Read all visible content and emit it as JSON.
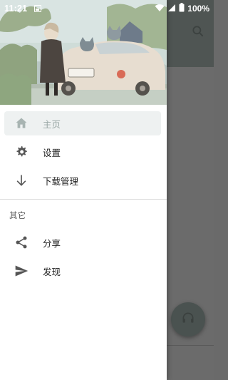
{
  "status_bar": {
    "time": "11:21",
    "battery": "100%"
  },
  "drawer": {
    "header_image": "anime-girl-with-car-illustration",
    "primary_items": [
      {
        "label": "主页",
        "icon": "home-icon",
        "active": true
      },
      {
        "label": "设置",
        "icon": "gear-icon",
        "active": false
      },
      {
        "label": "下载管理",
        "icon": "download-arrow-icon",
        "active": false
      }
    ],
    "section_title": "其它",
    "secondary_items": [
      {
        "label": "分享",
        "icon": "share-icon"
      },
      {
        "label": "发现",
        "icon": "send-icon"
      }
    ]
  },
  "colors": {
    "toolbar": "#4f5553",
    "active_item_bg": "#eef1f1",
    "active_item_text": "#9aa7a5",
    "scrim": "#6b6b6b"
  }
}
